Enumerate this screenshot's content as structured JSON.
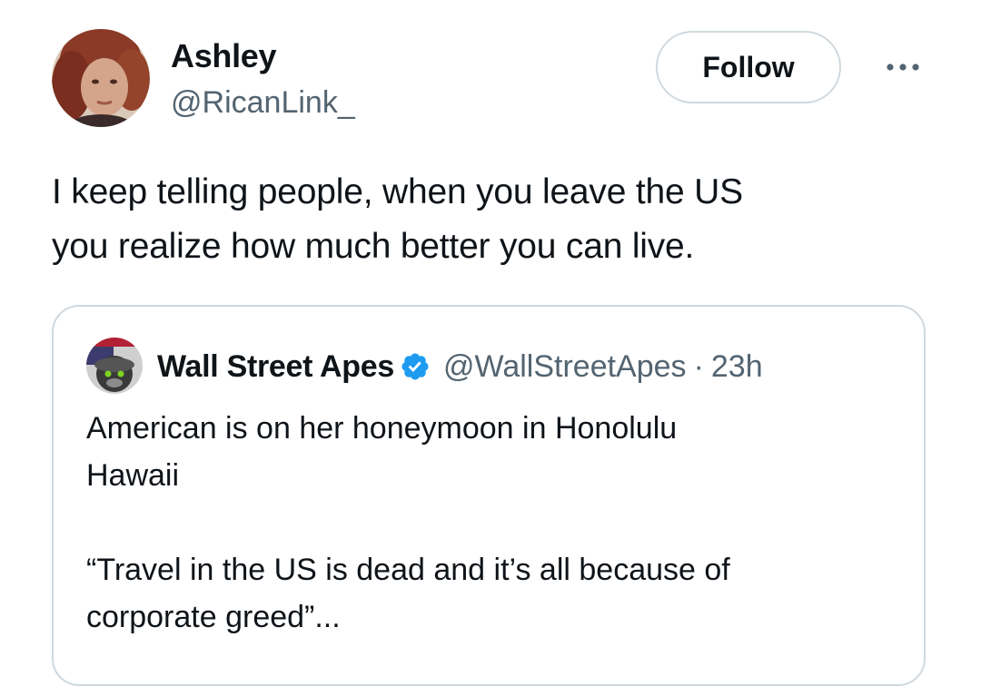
{
  "author": {
    "name": "Ashley",
    "handle": "@RicanLink_",
    "avatar_icon": "profile-photo"
  },
  "actions": {
    "follow_label": "Follow",
    "more_icon": "ellipsis-icon"
  },
  "tweet": {
    "text": "I keep telling people, when you leave the US\nyou realize how much better you can live."
  },
  "quoted": {
    "name": "Wall Street Apes",
    "verified_icon": "verified-badge",
    "handle": "@WallStreetApes",
    "separator": "·",
    "time": "23h",
    "text": "American is on her honeymoon in Honolulu\nHawaii\n\n“Travel in the US is dead and it’s all because of\ncorporate greed”..."
  },
  "colors": {
    "text_primary": "#0f1419",
    "text_secondary": "#536471",
    "border": "#cfd9de",
    "verified_blue": "#1d9bf0"
  }
}
